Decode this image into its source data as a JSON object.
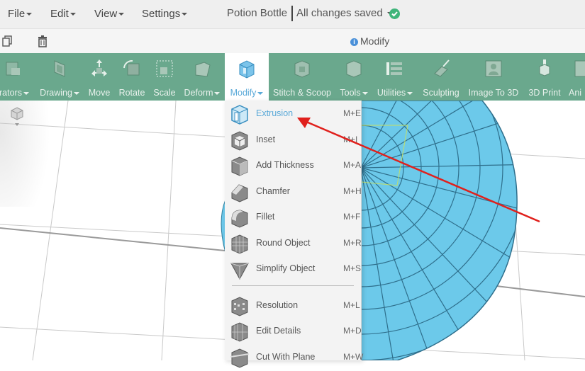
{
  "menubar": {
    "file": "File",
    "edit": "Edit",
    "view": "View",
    "settings": "Settings",
    "doc_title": "Potion Bottle",
    "doc_status": "All changes saved"
  },
  "subbar": {
    "mode_label": "Modify"
  },
  "toolbar": {
    "items": [
      {
        "label": "rators",
        "icon": "creators-icon"
      },
      {
        "label": "Drawing",
        "icon": "drawing-icon"
      },
      {
        "label": "Move",
        "icon": "move-icon"
      },
      {
        "label": "Rotate",
        "icon": "rotate-icon"
      },
      {
        "label": "Scale",
        "icon": "scale-icon"
      },
      {
        "label": "Deform",
        "icon": "deform-icon"
      },
      {
        "label": "Modify",
        "icon": "modify-icon"
      },
      {
        "label": "Stitch & Scoop",
        "icon": "stitch-scoop-icon"
      },
      {
        "label": "Tools",
        "icon": "tools-icon"
      },
      {
        "label": "Utilities",
        "icon": "utilities-icon"
      },
      {
        "label": "Sculpting",
        "icon": "sculpting-icon"
      },
      {
        "label": "Image To 3D",
        "icon": "image-to-3d-icon"
      },
      {
        "label": "3D Print",
        "icon": "3d-print-icon"
      },
      {
        "label": "Ani",
        "icon": "animation-icon"
      }
    ]
  },
  "modify_menu": {
    "items": [
      {
        "label": "Extrusion",
        "shortcut": "M+E",
        "icon": "extrusion-icon"
      },
      {
        "label": "Inset",
        "shortcut": "M+I",
        "icon": "inset-icon"
      },
      {
        "label": "Add Thickness",
        "shortcut": "M+A",
        "icon": "add-thickness-icon"
      },
      {
        "label": "Chamfer",
        "shortcut": "M+H",
        "icon": "chamfer-icon"
      },
      {
        "label": "Fillet",
        "shortcut": "M+F",
        "icon": "fillet-icon"
      },
      {
        "label": "Round Object",
        "shortcut": "M+R",
        "icon": "round-object-icon"
      },
      {
        "label": "Simplify Object",
        "shortcut": "M+S",
        "icon": "simplify-object-icon"
      },
      {
        "label": "Resolution",
        "shortcut": "M+L",
        "icon": "resolution-icon"
      },
      {
        "label": "Edit Details",
        "shortcut": "M+D",
        "icon": "edit-details-icon"
      },
      {
        "label": "Cut With Plane",
        "shortcut": "M+W",
        "icon": "cut-with-plane-icon"
      }
    ]
  },
  "colors": {
    "toolbar_bg": "#6aa88d",
    "accent_blue": "#5aa9d8",
    "sphere_fill": "#6cc9ea",
    "annotation_arrow": "#e0201c",
    "saved_check": "#3fb57a"
  }
}
